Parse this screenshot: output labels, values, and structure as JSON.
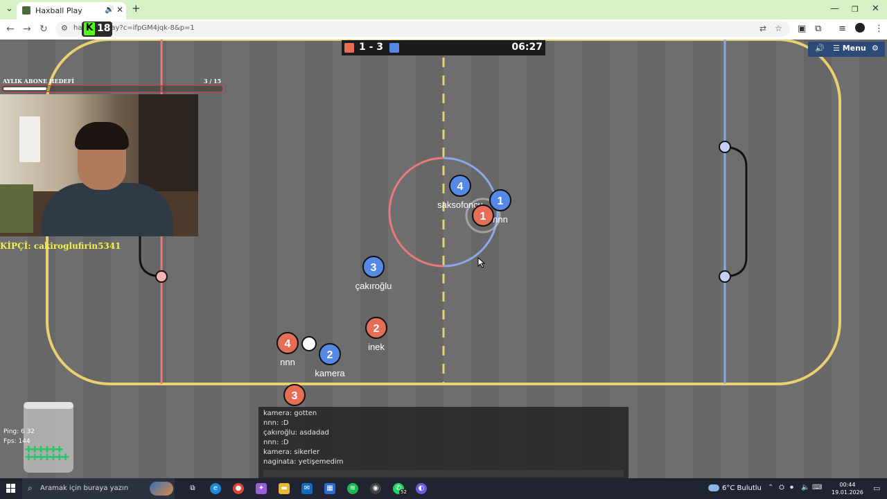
{
  "browser": {
    "tab_title": "Haxball Play",
    "new_tab": "+",
    "url_prefix": "hax",
    "url_rest": "ay?c=ifpGM4jqk-8&p=1"
  },
  "kick_badge": {
    "letter": "K",
    "number": "18"
  },
  "scoreboard": {
    "score": "1 - 3",
    "time": "06:27",
    "red_color": "#e56e56",
    "blue_color": "#5689e5"
  },
  "game_menu": {
    "sound_icon": "🔊",
    "menu_label": "☰ Menu",
    "settings_icon": "⚙"
  },
  "goal": {
    "label": "AYLIK ABONE HEDEFİ",
    "count": "3  / 15",
    "progress": 0.2
  },
  "donor_label": "KİPÇİ: cakiroglufirin5341",
  "stats": {
    "ping": "Ping: 6  32",
    "fps": "Fps: 144"
  },
  "players": [
    {
      "team": "blue",
      "number": "4",
      "name": "saksofoncu"
    },
    {
      "team": "blue",
      "number": "1",
      "name": "nnn"
    },
    {
      "team": "red",
      "number": "1",
      "name": ""
    },
    {
      "team": "blue",
      "number": "3",
      "name": "çakıroğlu"
    },
    {
      "team": "red",
      "number": "2",
      "name": "inek"
    },
    {
      "team": "red",
      "number": "4",
      "name": "nnn"
    },
    {
      "team": "blue",
      "number": "2",
      "name": "kamera"
    },
    {
      "team": "red",
      "number": "3",
      "name": ""
    }
  ],
  "chat": {
    "messages": [
      "kamera: gotten",
      "nnn: :D",
      "çakıroğlu: asdadad",
      "nnn: :D",
      "kamera: sikerler",
      "naginata: yetişemedim"
    ]
  },
  "taskbar": {
    "search_placeholder": "Aramak için buraya yazın",
    "whatsapp_badge": "52",
    "weather": "6°C  Bulutlu",
    "time": "00:44",
    "date": "19.01.2026"
  }
}
